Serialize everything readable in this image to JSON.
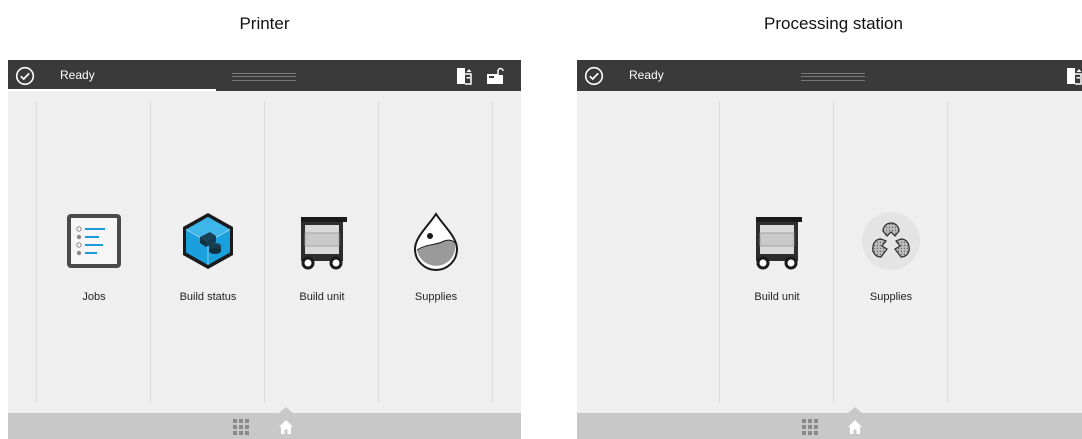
{
  "captions": {
    "left": "Printer",
    "right": "Processing station"
  },
  "printer": {
    "status": {
      "text": "Ready",
      "icon": "check-circle-icon"
    },
    "statusbar_icons": [
      "printer-eject-icon",
      "unlock-cover-icon"
    ],
    "tiles": [
      {
        "label": "Jobs",
        "icon": "jobs-list-icon"
      },
      {
        "label": "Build status",
        "icon": "build-status-cube-icon"
      },
      {
        "label": "Build unit",
        "icon": "build-unit-cart-icon"
      },
      {
        "label": "Supplies",
        "icon": "supplies-drop-icon"
      }
    ],
    "bottom_nav": [
      "apps-grid-icon",
      "home-icon"
    ]
  },
  "processing_station": {
    "status": {
      "text": "Ready",
      "icon": "check-circle-icon"
    },
    "statusbar_icons": [
      "printer-eject-icon"
    ],
    "tiles": [
      {
        "label": "Build unit",
        "icon": "build-unit-cart-icon"
      },
      {
        "label": "Supplies",
        "icon": "supplies-recycle-icon"
      }
    ],
    "bottom_nav": [
      "apps-grid-icon",
      "home-icon"
    ]
  },
  "colors": {
    "statusbar": "#3a3a3a",
    "panel": "#efefef",
    "bottombar": "#c8c8c8",
    "accent": "#1a9ad6"
  }
}
